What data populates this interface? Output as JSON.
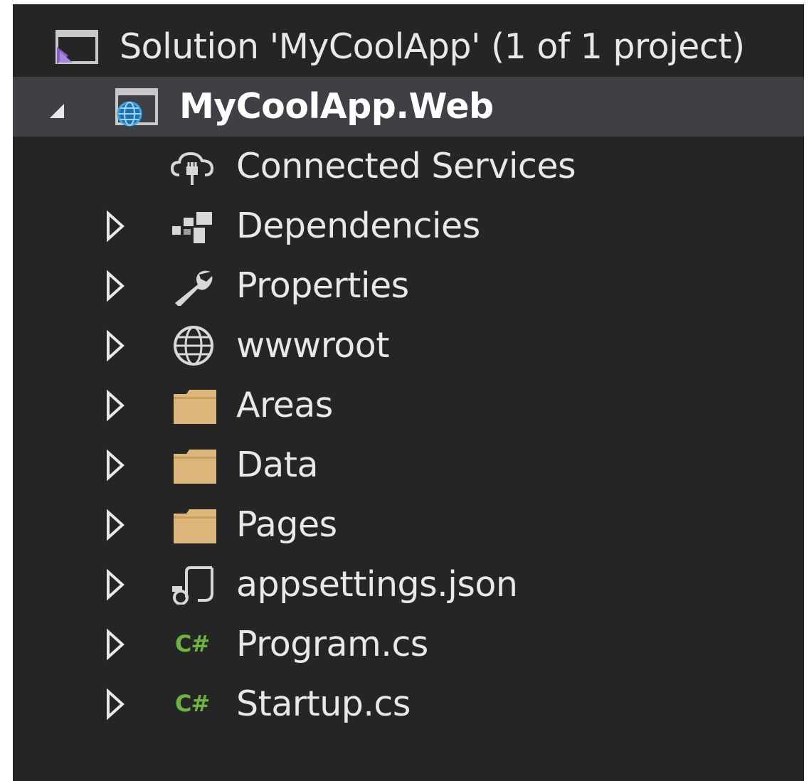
{
  "solution": {
    "label": "Solution 'MyCoolApp' (1 of 1 project)",
    "icon": "visual-studio-solution-icon"
  },
  "project": {
    "label": "MyCoolApp.Web",
    "icon": "web-project-icon",
    "expanded": true
  },
  "items": [
    {
      "label": "Connected Services",
      "icon": "connected-services-icon",
      "expandable": false
    },
    {
      "label": "Dependencies",
      "icon": "dependencies-icon",
      "expandable": true
    },
    {
      "label": "Properties",
      "icon": "wrench-icon",
      "expandable": true
    },
    {
      "label": "wwwroot",
      "icon": "globe-icon",
      "expandable": true
    },
    {
      "label": "Areas",
      "icon": "folder-icon",
      "expandable": true
    },
    {
      "label": "Data",
      "icon": "folder-icon",
      "expandable": true
    },
    {
      "label": "Pages",
      "icon": "folder-icon",
      "expandable": true
    },
    {
      "label": "appsettings.json",
      "icon": "json-file-icon",
      "expandable": true
    },
    {
      "label": "Program.cs",
      "icon": "csharp-file-icon",
      "expandable": true,
      "badge": "C#"
    },
    {
      "label": "Startup.cs",
      "icon": "csharp-file-icon",
      "expandable": true,
      "badge": "C#"
    }
  ],
  "colors": {
    "background": "#252526",
    "selected_row": "#3f3f46",
    "text": "#e8e8e8",
    "folder": "#dcb67a",
    "csharp": "#6db33f",
    "vs_purple": "#865fc5",
    "globe_blue": "#3ca8e6"
  }
}
